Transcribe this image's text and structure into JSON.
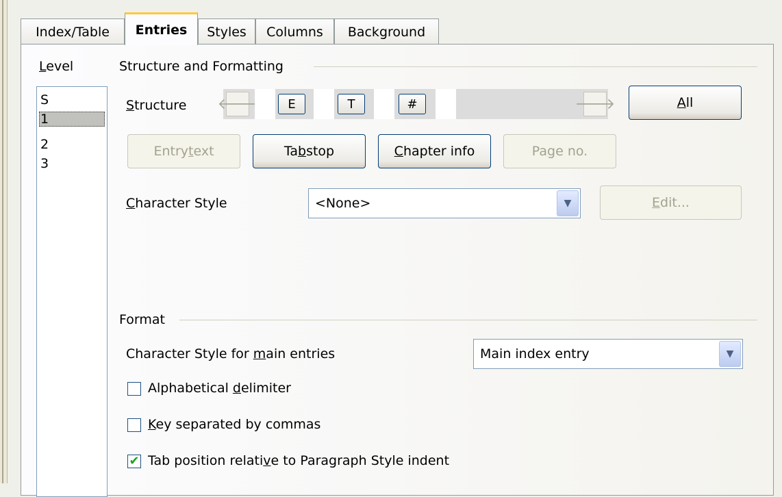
{
  "tabs": [
    {
      "label": "Index/Table"
    },
    {
      "label": "Entries"
    },
    {
      "label": "Styles"
    },
    {
      "label": "Columns"
    },
    {
      "label": "Background"
    }
  ],
  "level": {
    "label_first": "L",
    "label_rest": "evel",
    "items": [
      "S",
      "1",
      "2",
      "3"
    ],
    "selected": "1"
  },
  "structure_group": {
    "title": "Structure and Formatting",
    "structure_label_first": "S",
    "structure_label_rest": "tructure",
    "tokens": [
      "E",
      "T",
      "#"
    ],
    "left_arrow": "🡐",
    "right_arrow": "🡒",
    "all_button_first": "A",
    "all_button_rest": "ll",
    "entry_text_pre": "Entry ",
    "entry_text_u": "t",
    "entry_text_post": "ext",
    "tab_stop_pre": "Ta",
    "tab_stop_u": "b",
    "tab_stop_post": " stop",
    "chapter_info_u": "C",
    "chapter_info_post": "hapter info",
    "page_no_pre": "Pa",
    "page_no_u": "g",
    "page_no_post": "e no.",
    "char_style_u": "C",
    "char_style_post": "haracter Style",
    "char_style_value": "<None>",
    "edit_u": "E",
    "edit_post": "dit..."
  },
  "format_group": {
    "title": "Format",
    "main_entries_pre": "Character Style for ",
    "main_entries_u": "m",
    "main_entries_post": "ain entries",
    "main_entries_value": "Main index entry",
    "alpha_pre": "Alphabetical ",
    "alpha_u": "d",
    "alpha_post": "elimiter",
    "alpha_checked": false,
    "key_u": "K",
    "key_post": "ey separated by commas",
    "key_checked": false,
    "tabpos_pre": "Tab position relati",
    "tabpos_u": "v",
    "tabpos_post": "e to Paragraph Style indent",
    "tabpos_checked": true,
    "check_mark": "✔"
  },
  "colors": {
    "accent_tab": "#ffc83c",
    "button_border": "#003c74",
    "disabled_text": "#a3a290",
    "check_green": "#21a121"
  }
}
